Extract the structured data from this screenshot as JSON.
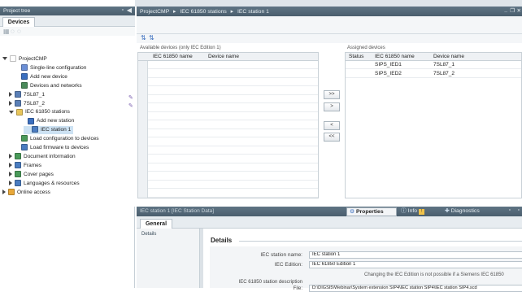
{
  "left_panel": {
    "title": "Project tree",
    "tab": "Devices",
    "tree": [
      {
        "label": "ProjectCMP",
        "indent": 0,
        "arrow": "down",
        "icon": "folder-icon",
        "color": "#ffffff"
      },
      {
        "label": "Single-line configuration",
        "indent": 2,
        "arrow": "",
        "icon": "single-line-icon",
        "color": "#6b8fd6"
      },
      {
        "label": "Add new device",
        "indent": 2,
        "arrow": "",
        "icon": "add-device-icon",
        "color": "#3b6fbf"
      },
      {
        "label": "Devices and networks",
        "indent": 2,
        "arrow": "",
        "icon": "network-icon",
        "color": "#4a8a5a"
      },
      {
        "label": "7SL87_1",
        "indent": 1,
        "arrow": "right",
        "icon": "device-icon",
        "color": "#5a7fb6"
      },
      {
        "label": "7SL87_2",
        "indent": 1,
        "arrow": "right",
        "icon": "device-icon",
        "color": "#5a7fb6"
      },
      {
        "label": "IEC 61850 stations",
        "indent": 1,
        "arrow": "down",
        "icon": "folder-icon",
        "color": "#e8c55a"
      },
      {
        "label": "Add new station",
        "indent": 3,
        "arrow": "",
        "icon": "add-station-icon",
        "color": "#3b6fbf"
      },
      {
        "label": "IEC station 1",
        "indent": 3,
        "arrow": "",
        "icon": "station-icon",
        "color": "#4a7cc0",
        "selected": true
      },
      {
        "label": "Load configuration to devices",
        "indent": 2,
        "arrow": "",
        "icon": "load-config-icon",
        "color": "#4a9a5a"
      },
      {
        "label": "Load firmware to devices",
        "indent": 2,
        "arrow": "",
        "icon": "load-firmware-icon",
        "color": "#4a7cc0"
      },
      {
        "label": "Document information",
        "indent": 1,
        "arrow": "right",
        "icon": "document-icon",
        "color": "#4a9a5a"
      },
      {
        "label": "Frames",
        "indent": 1,
        "arrow": "right",
        "icon": "frames-icon",
        "color": "#4a7cc0"
      },
      {
        "label": "Cover pages",
        "indent": 1,
        "arrow": "right",
        "icon": "cover-pages-icon",
        "color": "#4a9a5a"
      },
      {
        "label": "Languages & resources",
        "indent": 1,
        "arrow": "right",
        "icon": "languages-icon",
        "color": "#4a7cc0"
      },
      {
        "label": "Online access",
        "indent": 0,
        "arrow": "right",
        "icon": "online-access-icon",
        "color": "#e8a83a"
      }
    ]
  },
  "main": {
    "breadcrumb": [
      "ProjectCMP",
      "IEC 61850 stations",
      "IEC station 1"
    ],
    "window_controls": [
      "_",
      "❐",
      "✕"
    ],
    "available": {
      "title": "Available devices (only IEC Edition 1)",
      "columns": [
        "IEC 61850 name",
        "Device name"
      ]
    },
    "assigned": {
      "title": "Assigned devices",
      "columns": [
        "Status",
        "IEC 61850 name",
        "Device name"
      ],
      "rows": [
        {
          "status": "",
          "iec_name": "SIPS_IED1",
          "device": "7SL87_1"
        },
        {
          "status": "",
          "iec_name": "SIPS_IED2",
          "device": "7SL87_2"
        }
      ]
    },
    "transfer_buttons": [
      ">>",
      ">",
      "<",
      "<<"
    ]
  },
  "bottom": {
    "title": "IEC station 1 [IEC Station Data]",
    "tabs": [
      "Properties",
      "Info",
      "Diagnostics"
    ],
    "general_tab": "General",
    "side_nav": "Details",
    "section_title": "Details",
    "fields": {
      "name_label": "IEC station name:",
      "name_value": "IEC station 1",
      "edition_label": "IEC Edition:",
      "edition_value": "IEC 61850 Edition 1",
      "note": "Changing the IEC Edition is not possible if a Siemens IEC 61850",
      "desc_label": "IEC 61850 station description",
      "file_label": "File:",
      "file_value": "D:\\DIGSI5\\Webinar\\System extension SIP4\\IEC station SIP4\\IEC station SIP4.scd"
    }
  }
}
